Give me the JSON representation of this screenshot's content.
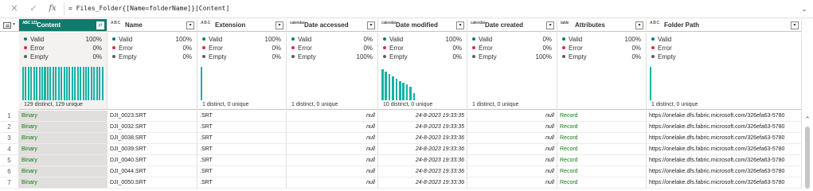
{
  "formula_bar": {
    "cancel_icon": "close-icon",
    "confirm_icon": "check-icon",
    "fx_label": "fx",
    "formula": "= Files_Folder{[Name=folderName]}[Content]"
  },
  "columns": [
    {
      "type_label": "ABC 123",
      "name": "Content",
      "selected": true
    },
    {
      "type_label": "A B C",
      "name": "Name"
    },
    {
      "type_label": "A B C",
      "name": "Extension"
    },
    {
      "type_label": "calendar",
      "name": "Date accessed"
    },
    {
      "type_label": "calendar",
      "name": "Date modified"
    },
    {
      "type_label": "calendar",
      "name": "Date created"
    },
    {
      "type_label": "table",
      "name": "Attributes"
    },
    {
      "type_label": "A B C",
      "name": "Folder Path"
    }
  ],
  "quality_labels": {
    "valid": "Valid",
    "error": "Error",
    "empty": "Empty"
  },
  "quality": [
    {
      "valid": "100%",
      "error": "0%",
      "empty": "0%"
    },
    {
      "valid": "100%",
      "error": "0%",
      "empty": "0%"
    },
    {
      "valid": "100%",
      "error": "0%",
      "empty": "0%"
    },
    {
      "valid": "0%",
      "error": "0%",
      "empty": "100%"
    },
    {
      "valid": "100%",
      "error": "0%",
      "empty": "0%"
    },
    {
      "valid": "0%",
      "error": "0%",
      "empty": "100%"
    },
    {
      "valid": "100%",
      "error": "0%",
      "empty": "0%"
    },
    {
      "valid": "",
      "error": "",
      "empty": ""
    }
  ],
  "distinct": [
    "129 distinct, 129 unique",
    "",
    "1 distinct, 0 unique",
    "1 distinct, 0 unique",
    "10 distinct, 0 unique",
    "1 distinct, 0 unique",
    "",
    "1 distinct, 0 unique"
  ],
  "histograms": {
    "content": [
      1,
      1,
      1,
      1,
      1,
      1,
      1,
      1,
      1,
      1,
      1,
      1,
      1,
      1,
      1,
      1,
      1,
      1,
      1,
      1,
      1,
      1,
      1,
      1,
      1,
      1,
      1,
      1,
      1,
      1
    ],
    "extension": [
      1
    ],
    "date_modified": [
      0.92,
      0.86,
      0.79,
      0.72,
      0.64,
      0.57,
      0.52,
      0.47,
      0.4,
      0.22
    ],
    "folder_path": [
      1
    ]
  },
  "rows": [
    {
      "num": "1",
      "content": "Binary",
      "name": "DJI_0023.SRT",
      "extension": ".SRT",
      "date_accessed": "null",
      "date_modified": "24-8-2023 19:33:35",
      "date_created": "null",
      "attributes": "Record",
      "folder_path": "https://onelake.dfs.fabric.microsoft.com/326efa63-5780"
    },
    {
      "num": "2",
      "content": "Binary",
      "name": "DJI_0032.SRT",
      "extension": ".SRT",
      "date_accessed": "null",
      "date_modified": "24-8-2023 19:33:35",
      "date_created": "null",
      "attributes": "Record",
      "folder_path": "https://onelake.dfs.fabric.microsoft.com/326efa63-5780"
    },
    {
      "num": "3",
      "content": "Binary",
      "name": "DJI_0038.SRT",
      "extension": ".SRT",
      "date_accessed": "null",
      "date_modified": "24-8-2023 19:33:36",
      "date_created": "null",
      "attributes": "Record",
      "folder_path": "https://onelake.dfs.fabric.microsoft.com/326efa63-5780"
    },
    {
      "num": "4",
      "content": "Binary",
      "name": "DJI_0039.SRT",
      "extension": ".SRT",
      "date_accessed": "null",
      "date_modified": "24-8-2023 19:33:36",
      "date_created": "null",
      "attributes": "Record",
      "folder_path": "https://onelake.dfs.fabric.microsoft.com/326efa63-5780"
    },
    {
      "num": "5",
      "content": "Binary",
      "name": "DJI_0040.SRT",
      "extension": ".SRT",
      "date_accessed": "null",
      "date_modified": "24-8-2023 19:33:36",
      "date_created": "null",
      "attributes": "Record",
      "folder_path": "https://onelake.dfs.fabric.microsoft.com/326efa63-5780"
    },
    {
      "num": "6",
      "content": "Binary",
      "name": "DJI_0044.SRT",
      "extension": ".SRT",
      "date_accessed": "null",
      "date_modified": "24-8-2023 19:33:36",
      "date_created": "null",
      "attributes": "Record",
      "folder_path": "https://onelake.dfs.fabric.microsoft.com/326efa63-5780"
    },
    {
      "num": "7",
      "content": "Binary",
      "name": "DJI_0050.SRT",
      "extension": ".SRT",
      "date_accessed": "null",
      "date_modified": "24-8-2023 19:33:36",
      "date_created": "null",
      "attributes": "Record",
      "folder_path": "https://onelake.dfs.fabric.microsoft.com/326efa63-5780"
    }
  ],
  "colors": {
    "accent": "#0f7b6c",
    "bar": "#17b2a4",
    "valid": "#0f7b6c",
    "error": "#d13438",
    "empty": "#605e5c",
    "link": "#107c10"
  }
}
